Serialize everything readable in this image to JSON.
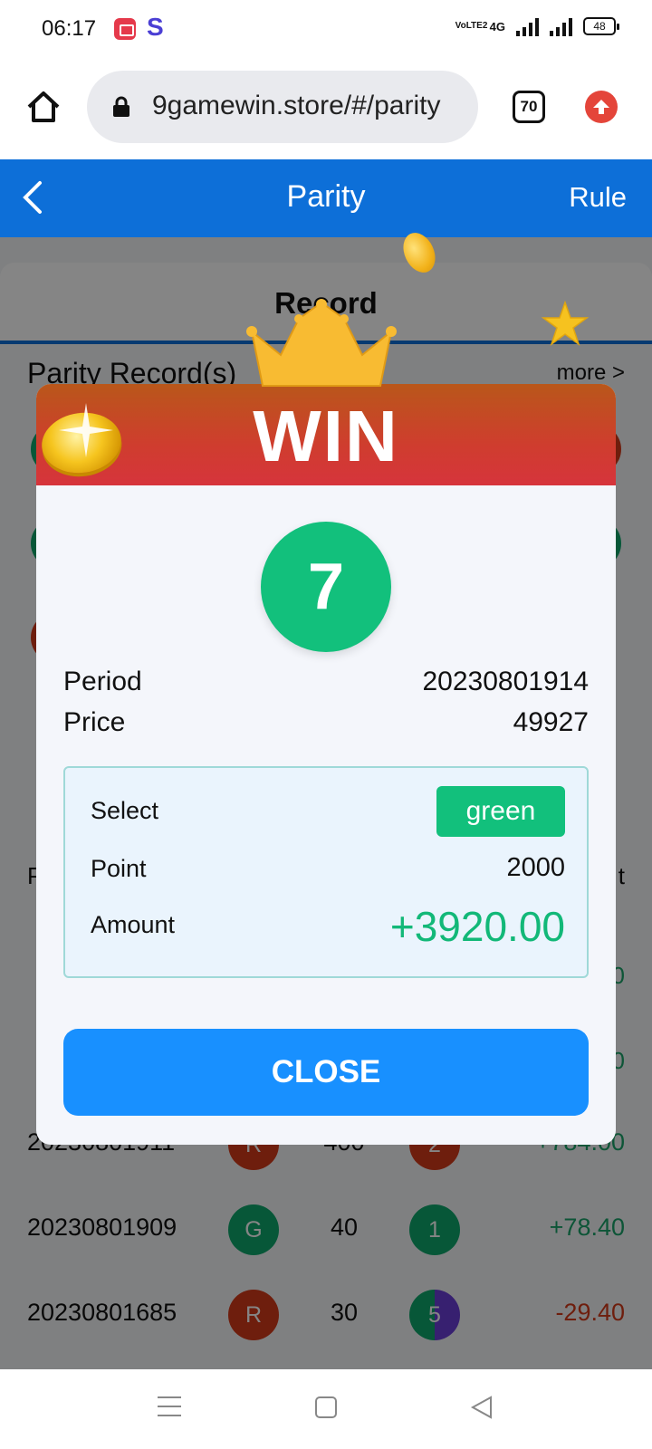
{
  "status_bar": {
    "time": "06:17",
    "network": "4G",
    "volte_label": "VoLTE2",
    "battery": "48"
  },
  "browser": {
    "url": "9gamewin.store/#/parity",
    "tab_count": "70"
  },
  "header": {
    "title": "Parity",
    "rule_label": "Rule"
  },
  "page": {
    "record_tab": "Record",
    "parity_record_title": "Parity Record(s)",
    "more_link": "more >",
    "col_period": "P",
    "col_amount": "t",
    "partial_amounts": [
      "0",
      "0"
    ],
    "records": [
      {
        "period": "20230801911",
        "select": "R",
        "select_color": "#d43a1a",
        "point": "400",
        "result": "2",
        "result_color": "#d43a1a",
        "amount": "+784.00",
        "amount_color": "#1aa36a"
      },
      {
        "period": "20230801909",
        "select": "G",
        "select_color": "#0fa86c",
        "point": "40",
        "result": "1",
        "result_color": "#0fa86c",
        "amount": "+78.40",
        "amount_color": "#1aa36a"
      },
      {
        "period": "20230801685",
        "select": "R",
        "select_color": "#d43a1a",
        "point": "30",
        "result": "5",
        "result_color": "split-green-violet",
        "amount": "-29.40",
        "amount_color": "#d43a1a"
      }
    ]
  },
  "modal": {
    "title": "WIN",
    "result_number": "7",
    "result_color": "#12c07c",
    "period_label": "Period",
    "period_value": "20230801914",
    "price_label": "Price",
    "price_value": "49927",
    "select_label": "Select",
    "select_value": "green",
    "point_label": "Point",
    "point_value": "2000",
    "amount_label": "Amount",
    "amount_value": "+3920.00",
    "close_label": "CLOSE"
  },
  "icons": {
    "home": "home-icon",
    "lock": "lock-icon",
    "tabs": "tabs-icon",
    "upgrade": "upgrade-icon",
    "back": "back-icon",
    "crown": "crown-icon",
    "coin": "coin-icon",
    "star": "star-icon"
  },
  "colors": {
    "header_blue": "#0d6fd8",
    "win_red": "#d6343c",
    "green": "#12c07c",
    "close_blue": "#1890ff"
  }
}
